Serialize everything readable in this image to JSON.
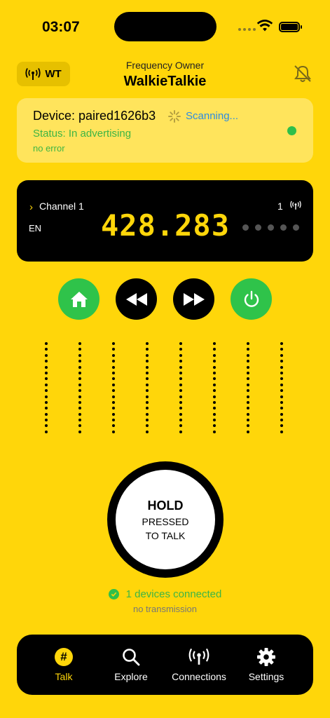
{
  "status_bar": {
    "time": "03:07"
  },
  "header": {
    "badge_label": "WT",
    "subtitle": "Frequency Owner",
    "title": "WalkieTalkie"
  },
  "device": {
    "name": "Device: paired1626b3",
    "scanning": "Scanning...",
    "status": "Status: In advertising",
    "error": "no error"
  },
  "channel": {
    "label": "Channel 1",
    "lang": "EN",
    "frequency": "428.283",
    "number": "1"
  },
  "ptt": {
    "hold": "HOLD",
    "line1": "PRESSED",
    "line2": "TO TALK"
  },
  "connection": {
    "connected": "1 devices connected",
    "transmission": "no transmission"
  },
  "tabs": [
    {
      "label": "Talk",
      "icon": "hash-icon"
    },
    {
      "label": "Explore",
      "icon": "search-icon"
    },
    {
      "label": "Connections",
      "icon": "antenna-icon"
    },
    {
      "label": "Settings",
      "icon": "gear-icon"
    }
  ],
  "colors": {
    "background": "#FFD60A",
    "accent_green": "#2FC34A",
    "scanning_blue": "#2D8CE0",
    "panel_black": "#000000"
  }
}
